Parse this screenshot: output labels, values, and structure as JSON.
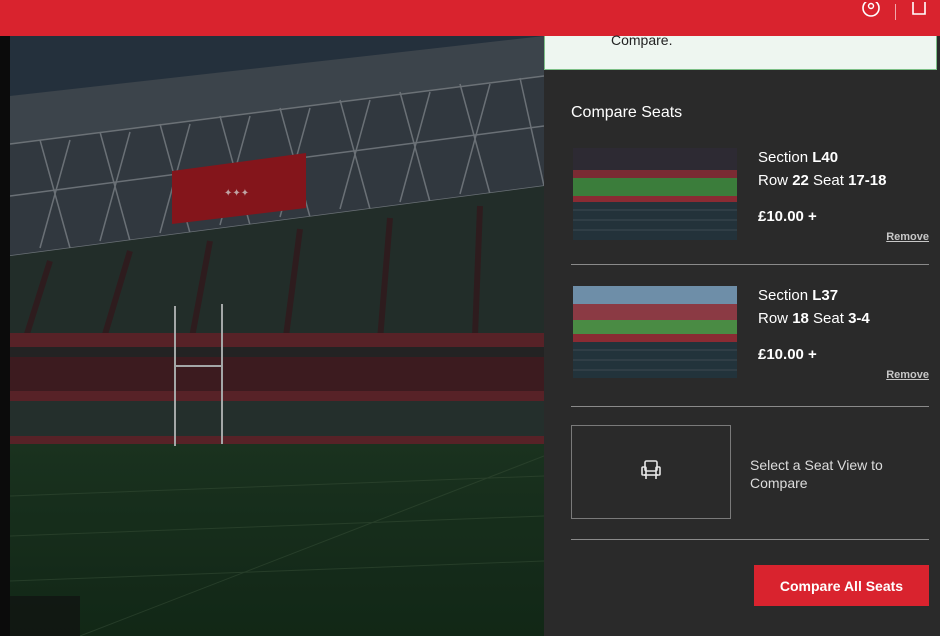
{
  "notice": {
    "text": "Compare."
  },
  "panel": {
    "title": "Compare Seats",
    "seats": [
      {
        "section_label": "Section",
        "section": "L40",
        "row_label": "Row",
        "row": "22",
        "seat_label": "Seat",
        "seat": "17-18",
        "price": "£10.00 +",
        "remove": "Remove"
      },
      {
        "section_label": "Section",
        "section": "L37",
        "row_label": "Row",
        "row": "18",
        "seat_label": "Seat",
        "seat": "3-4",
        "price": "£10.00 +",
        "remove": "Remove"
      }
    ],
    "placeholder": {
      "text": "Select a Seat View to Compare",
      "icon": "seat-icon"
    },
    "compare_button": "Compare All Seats"
  },
  "header": {
    "icons": [
      "user-icon",
      "basket-icon"
    ]
  },
  "colors": {
    "brand": "#d9232e",
    "panel": "#2a2a2a",
    "notice_bg": "#eef6f0",
    "notice_border": "#7cbf86"
  }
}
